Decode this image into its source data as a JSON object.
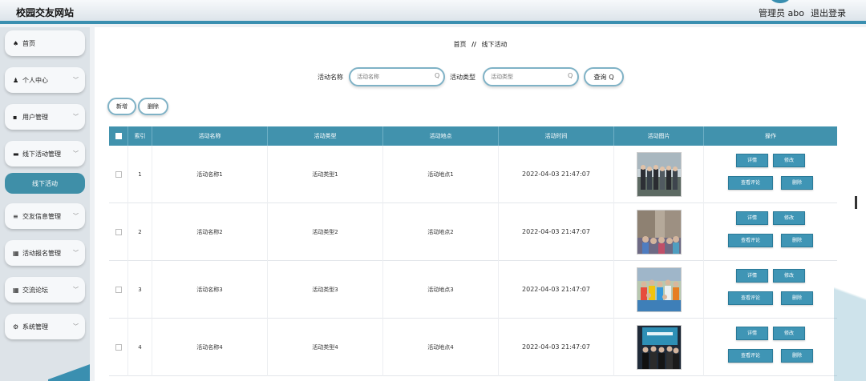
{
  "header": {
    "site_title": "校园交友网站",
    "admin_label": "管理员 abo",
    "logout_label": "退出登录"
  },
  "sidebar": {
    "items": [
      {
        "label": "首页",
        "icon": "home-icon",
        "glyph": "♠"
      },
      {
        "label": "个人中心",
        "icon": "user-icon",
        "glyph": "♟"
      },
      {
        "label": "用户管理",
        "icon": "user-manage-icon",
        "glyph": "▪"
      },
      {
        "label": "线下活动管理",
        "icon": "activity-icon",
        "glyph": "▬"
      },
      {
        "label": "线下活动",
        "icon": "",
        "glyph": ""
      },
      {
        "label": "交友信息管理",
        "icon": "list-icon",
        "glyph": "≡"
      },
      {
        "label": "活动报名管理",
        "icon": "grid-icon",
        "glyph": "▦"
      },
      {
        "label": "交流论坛",
        "icon": "grid-icon",
        "glyph": "▦"
      },
      {
        "label": "系统管理",
        "icon": "settings-icon",
        "glyph": "⚙"
      }
    ],
    "chevron": "﹀"
  },
  "breadcrumb": {
    "home": "首页",
    "separator": "//",
    "current": "线下活动"
  },
  "search": {
    "name_label": "活动名称",
    "name_placeholder": "活动名称",
    "type_label": "活动类型",
    "type_placeholder": "活动类型",
    "button_label": "查询",
    "search_glyph": "Q"
  },
  "actions": {
    "add_label": "新增",
    "delete_label": "删除"
  },
  "table": {
    "columns": [
      "索引",
      "活动名称",
      "活动类型",
      "活动地点",
      "活动时间",
      "活动图片",
      "操作"
    ],
    "rows": [
      {
        "index": "1",
        "name": "活动名称1",
        "type": "活动类型1",
        "place": "活动地点1",
        "time": "2022-04-03 21:47:07"
      },
      {
        "index": "2",
        "name": "活动名称2",
        "type": "活动类型2",
        "place": "活动地点2",
        "time": "2022-04-03 21:47:07"
      },
      {
        "index": "3",
        "name": "活动名称3",
        "type": "活动类型3",
        "place": "活动地点3",
        "time": "2022-04-03 21:47:07"
      },
      {
        "index": "4",
        "name": "活动名称4",
        "type": "活动类型4",
        "place": "活动地点4",
        "time": "2022-04-03 21:47:07"
      }
    ],
    "op_labels": {
      "detail": "详情",
      "edit": "修改",
      "comment": "查看评论",
      "delete": "删除"
    }
  },
  "colors": {
    "accent": "#3a8fb0",
    "table_header": "#4192ad",
    "op_button": "#3f95b5"
  }
}
